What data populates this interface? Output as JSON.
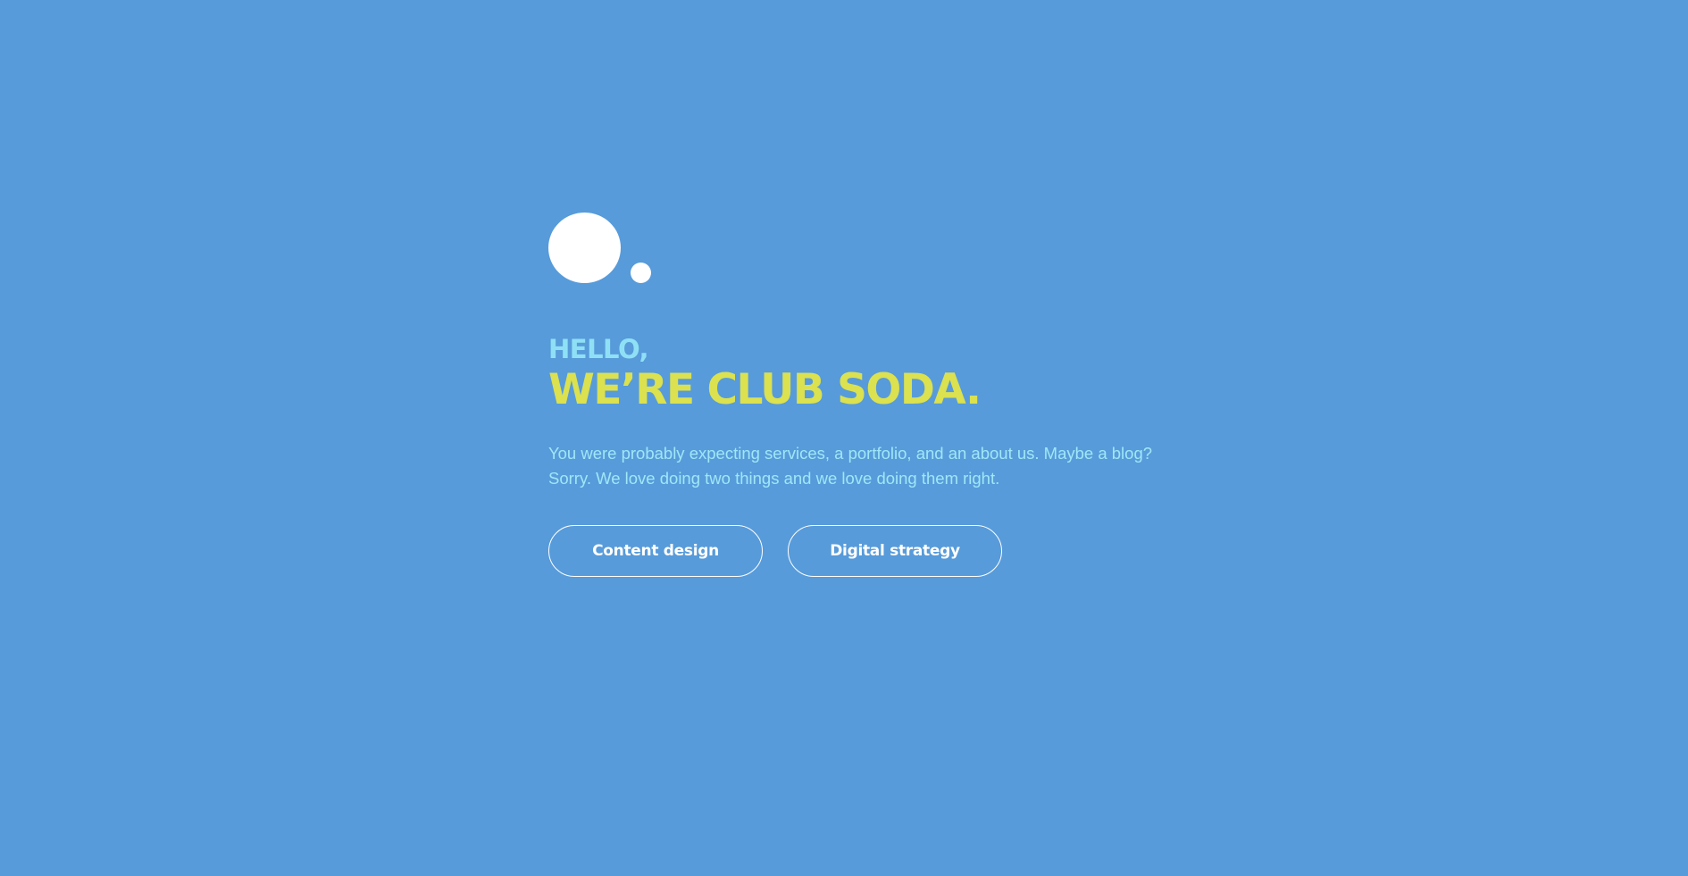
{
  "logo": {
    "icon": "two-dots-logo",
    "color": "#ffffff"
  },
  "hero": {
    "greeting": "HELLO,",
    "headline": "WE’RE CLUB SODA.",
    "intro_line_1": "You were probably expecting services, a portfolio, and an about us. Maybe a blog?",
    "intro_line_2": "Sorry. We love doing two things and we love doing them right."
  },
  "buttons": {
    "content_design": "Content design",
    "digital_strategy": "Digital strategy"
  },
  "colors": {
    "background": "#579bda",
    "greeting": "#8fe0f5",
    "headline": "#dbe14f",
    "intro": "#9fe7f7",
    "button_border": "#ffffff"
  }
}
